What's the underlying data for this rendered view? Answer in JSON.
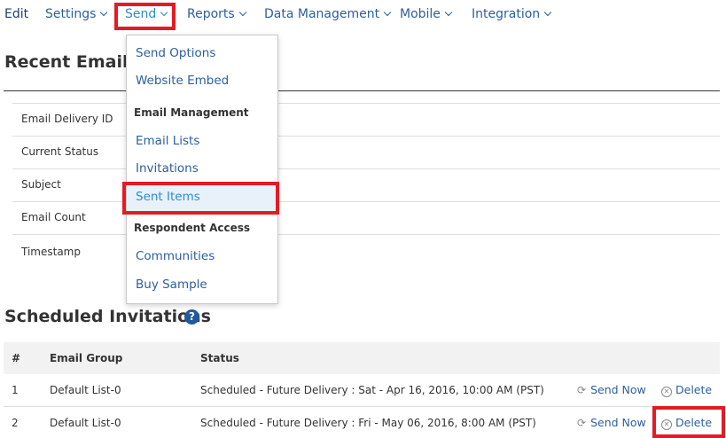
{
  "nav": {
    "edit": "Edit",
    "settings": "Settings",
    "send": "Send",
    "reports": "Reports",
    "data_management": "Data Management",
    "mobile": "Mobile",
    "integration": "Integration"
  },
  "recent": {
    "title": "Recent Email De",
    "rows": [
      {
        "label": "Email Delivery ID"
      },
      {
        "label": "Current Status"
      },
      {
        "label": "Subject"
      },
      {
        "label": "Email Count"
      },
      {
        "label": "Timestamp"
      }
    ]
  },
  "dropdown": {
    "send_options": "Send Options",
    "website_embed": "Website Embed",
    "email_management_header": "Email Management",
    "email_lists": "Email Lists",
    "invitations": "Invitations",
    "sent_items": "Sent Items",
    "respondent_access_header": "Respondent Access",
    "communities": "Communities",
    "buy_sample": "Buy Sample"
  },
  "scheduled": {
    "title": "Scheduled Invitations",
    "help_glyph": "?",
    "headers": {
      "num": "#",
      "group": "Email Group",
      "status": "Status"
    },
    "rows": [
      {
        "num": "1",
        "group": "Default List-0",
        "status": "Scheduled - Future Delivery : Sat - Apr 16, 2016, 10:00 AM (PST)",
        "send_now": "Send Now",
        "delete": "Delete"
      },
      {
        "num": "2",
        "group": "Default List-0",
        "status": "Scheduled - Future Delivery : Fri - May 06, 2016, 8:00 AM (PST)",
        "send_now": "Send Now",
        "delete": "Delete"
      }
    ]
  },
  "colors": {
    "link": "#2c5f9e",
    "active_link": "#2c8ccf",
    "highlight": "#e31b23",
    "help_icon": "#1f5a9e"
  }
}
